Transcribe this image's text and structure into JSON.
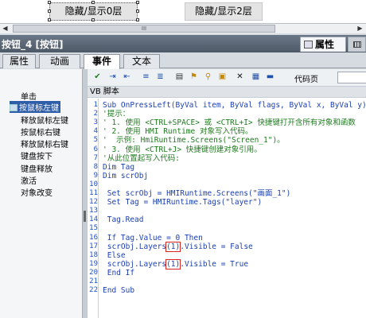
{
  "canvas": {
    "button1_label": "隐藏/显示0层",
    "button2_label": "隐藏/显示2层"
  },
  "scrollbar": {
    "left_arrow": "◀",
    "right_arrow": "▶",
    "thumb_grip": "III"
  },
  "titlebar": {
    "title": "按钮_4 [按钮]",
    "properties_tab": "属性"
  },
  "tabs": [
    {
      "label": "属性",
      "active": false
    },
    {
      "label": "动画",
      "active": false
    },
    {
      "label": "事件",
      "active": true
    },
    {
      "label": "文本",
      "active": false
    }
  ],
  "events": [
    {
      "label": "单击"
    },
    {
      "label": "按鼠标左键",
      "selected": true
    },
    {
      "label": "释放鼠标左键"
    },
    {
      "label": "按鼠标右键"
    },
    {
      "label": "释放鼠标右键"
    },
    {
      "label": "键盘按下"
    },
    {
      "label": "键盘释放"
    },
    {
      "label": "激活"
    },
    {
      "label": "对象改变"
    }
  ],
  "toolbar": {
    "codepage_label": "代码页",
    "icons": [
      "check-icon",
      "indent-icon",
      "outdent-icon",
      "comment-icon",
      "uncomment-icon",
      "list-icon",
      "bookmark-icon",
      "find-icon",
      "paste-icon",
      "delete-icon",
      "table-icon",
      "window-icon"
    ]
  },
  "editor": {
    "header": "VB 脚本",
    "lines": [
      {
        "n": "1",
        "text": "Sub OnPressLeft(ByVal item, ByVal flags, ByVal x, ByVal y)",
        "comment": false
      },
      {
        "n": "2",
        "text": "'提示：",
        "comment": true
      },
      {
        "n": "3",
        "text": "' 1. 使用 <CTRL+SPACE> 或 <CTRL+I> 快捷键打开含所有对象和函数",
        "comment": true
      },
      {
        "n": "4",
        "text": "' 2. 使用 HMI Runtime 对象写入代码。",
        "comment": true
      },
      {
        "n": "5",
        "text": "'  示例: HmiRuntime.Screens(\"Screen_1\")。",
        "comment": true
      },
      {
        "n": "6",
        "text": "' 3. 使用 <CTRL+J> 快捷键创建对象引用。",
        "comment": true
      },
      {
        "n": "7",
        "text": "'从此位置起写入代码:",
        "comment": true
      },
      {
        "n": "8",
        "text": "Dim Tag",
        "comment": false
      },
      {
        "n": "9",
        "text": "Dim scrObj",
        "comment": false
      },
      {
        "n": "10",
        "text": "",
        "comment": false
      },
      {
        "n": "11",
        "text": " Set scrObj = HMIRuntime.Screens(\"画面_1\")",
        "comment": false
      },
      {
        "n": "12",
        "text": " Set Tag = HMIRuntime.Tags(\"layer\")",
        "comment": false
      },
      {
        "n": "13",
        "text": "",
        "comment": false
      },
      {
        "n": "14",
        "text": " Tag.Read",
        "comment": false
      },
      {
        "n": "15",
        "text": "",
        "comment": false
      },
      {
        "n": "16",
        "text": " If Tag.Value = 0 Then",
        "comment": false
      },
      {
        "n": "17",
        "text": " scrObj.Layers(1).Visible = False",
        "comment": false
      },
      {
        "n": "18",
        "text": " Else",
        "comment": false
      },
      {
        "n": "19",
        "text": " scrObj.Layers(1).Visible = True",
        "comment": false
      },
      {
        "n": "20",
        "text": " End If",
        "comment": false
      },
      {
        "n": "21",
        "text": "",
        "comment": false
      },
      {
        "n": "22",
        "text": "End Sub",
        "comment": false
      }
    ]
  },
  "colors": {
    "keyword": "#1b3fb0",
    "comment": "#1e7a1e",
    "selection": "#2f5ea8",
    "highlight_box": "#d9261c"
  }
}
